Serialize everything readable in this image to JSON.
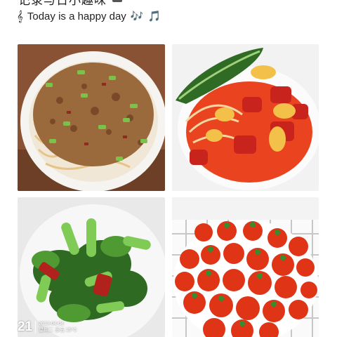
{
  "header": {
    "title": "记录与日小趣味",
    "subtitle": "Today is a happy day",
    "lead_icon": "treble-clef-icon",
    "music_icons": [
      "🎶",
      "🎵"
    ]
  },
  "photos": [
    {
      "name": "noodles-with-minced-meat"
    },
    {
      "name": "tomato-egg-noodles"
    },
    {
      "name": "stir-fried-greens"
    },
    {
      "name": "cherry-tomatoes"
    }
  ],
  "watermark": {
    "day": "21",
    "date": "2023-04-04",
    "weekday": "星期二 多云 15°C"
  },
  "colors": {
    "bowl_white": "#f4f2ef",
    "tomato_red": "#d8321f",
    "green": "#3f8a2a",
    "noodle": "#e8c489"
  }
}
